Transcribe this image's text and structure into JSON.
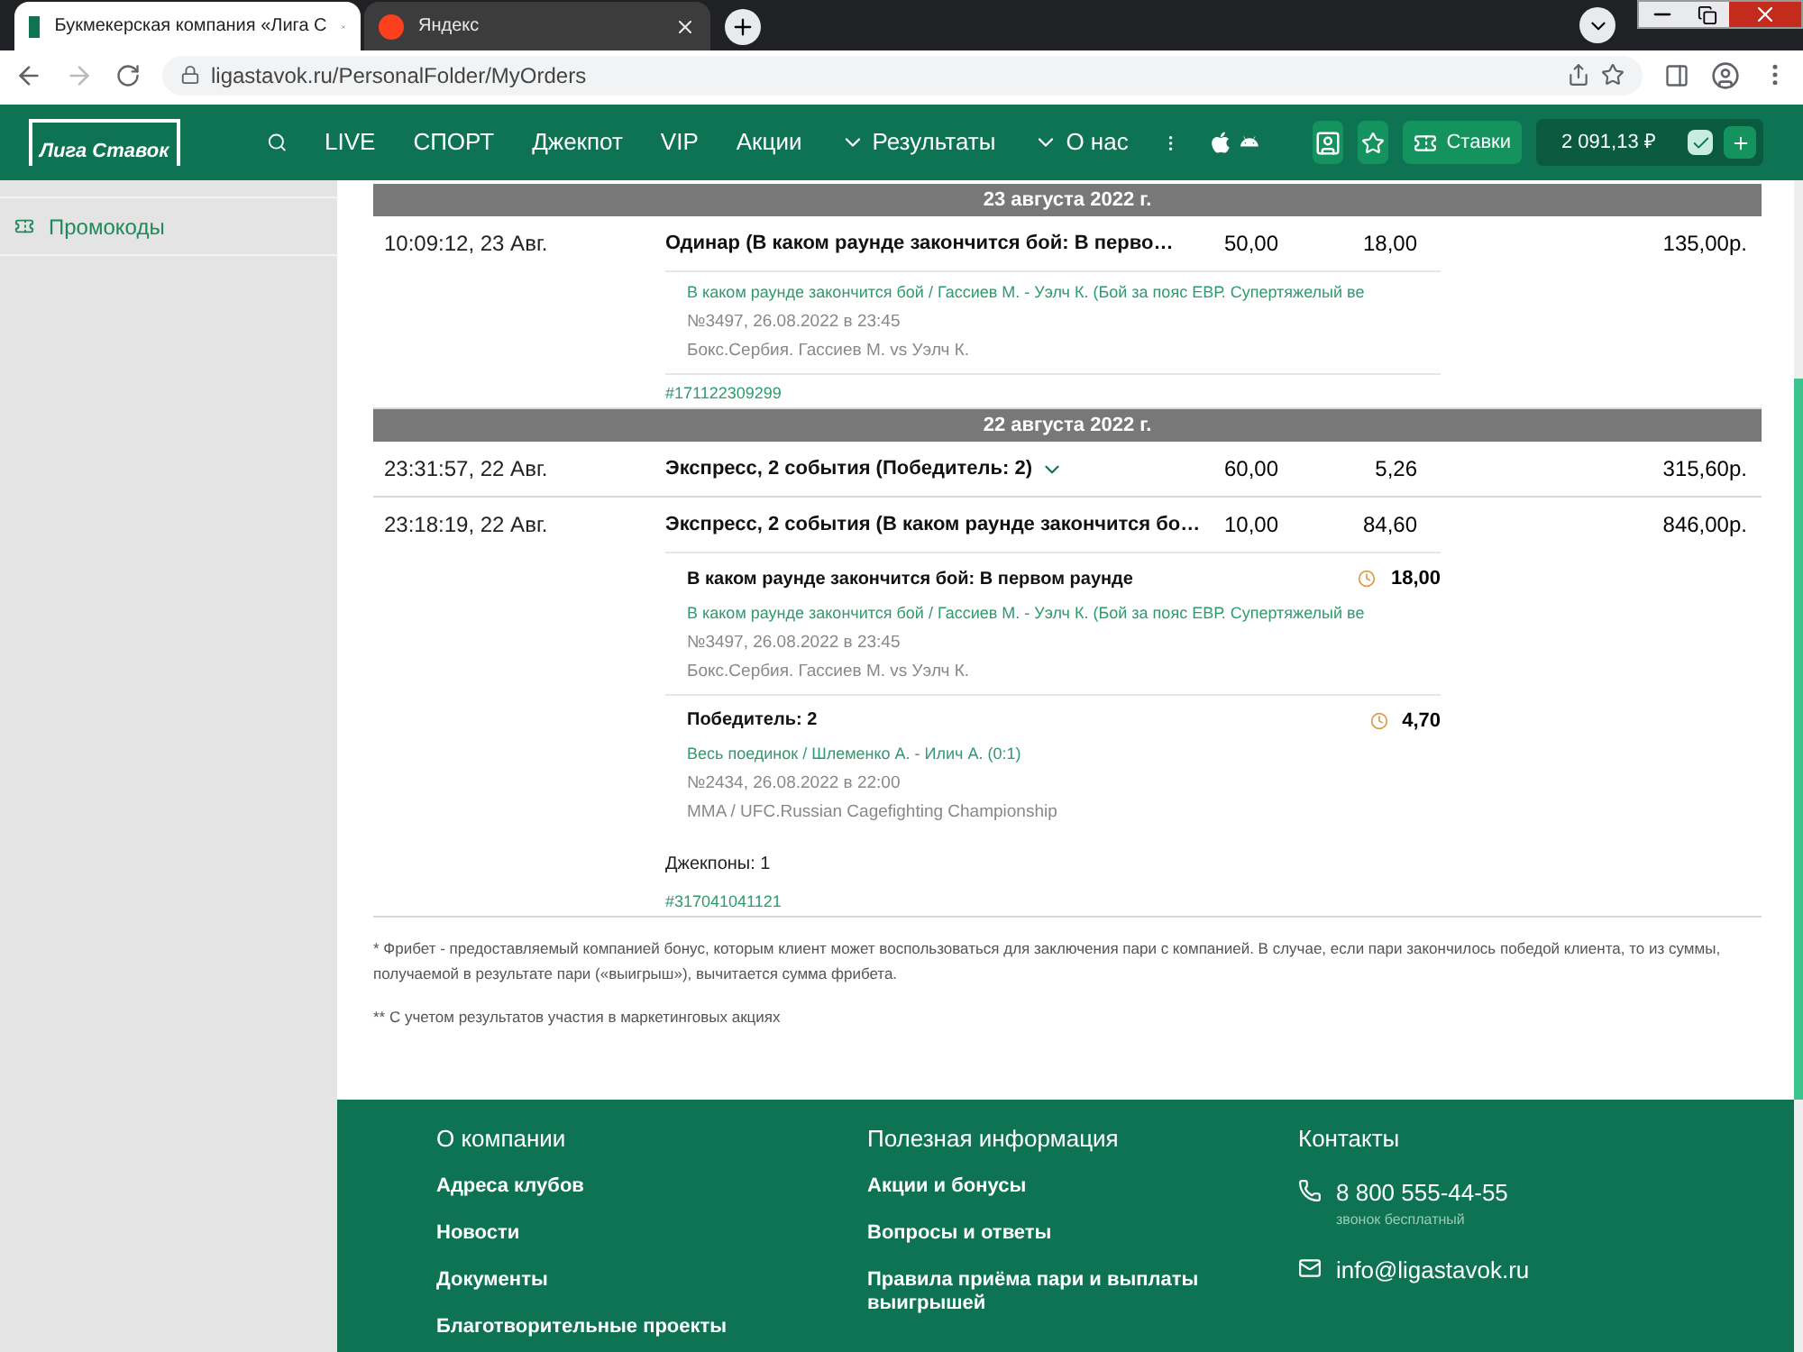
{
  "browser": {
    "tabs": [
      {
        "title": "Букмекерская компания «Лига С",
        "selected": true,
        "kind": "site"
      },
      {
        "title": "Яндекс",
        "selected": false,
        "kind": "yandex"
      }
    ],
    "url": "ligastavok.ru/PersonalFolder/MyOrders"
  },
  "header": {
    "logo": "Лига Ставок",
    "nav": [
      {
        "label": "LIVE",
        "kind": "link"
      },
      {
        "label": "СПОРТ",
        "kind": "link"
      },
      {
        "label": "Джекпот",
        "kind": "link"
      },
      {
        "label": "VIP",
        "kind": "link"
      },
      {
        "label": "Акции",
        "kind": "link"
      },
      {
        "label": "Результаты",
        "kind": "dropdown"
      },
      {
        "label": "О нас",
        "kind": "dropdown"
      }
    ],
    "bets_button": "Ставки",
    "balance": "2 091,13 ₽"
  },
  "sidebar": {
    "items": [
      {
        "label": "Промокоды"
      }
    ]
  },
  "groups": [
    {
      "date": "23 августа 2022 г.",
      "orders": [
        {
          "time": "10:09:12, 23 Авг.",
          "title": "Одинар (В каком раунде закончится бой: В перво…",
          "expanded": true,
          "stake": "50,00",
          "coef": "18,00",
          "payout": "135,00р.",
          "selections": [
            {
              "market": "В каком раунде закончится бой / Гассиев М. - Уэлч К. (Бой за пояс ЕВР. Супертяжелый ве",
              "event": "№3497, 26.08.2022 в 23:45",
              "league": "Бокс.Сербия. Гассиев М. vs Уэлч К."
            }
          ],
          "id": "#171122309299"
        }
      ]
    },
    {
      "date": "22 августа 2022 г.",
      "orders": [
        {
          "time": "23:31:57, 22 Авг.",
          "title": "Экспресс, 2 события (Победитель: 2)",
          "expanded": false,
          "stake": "60,00",
          "coef": "5,26",
          "payout": "315,60р."
        },
        {
          "time": "23:18:19, 22 Авг.",
          "title": "Экспресс, 2 события (В каком раунде закончится бо…",
          "expanded": true,
          "stake": "10,00",
          "coef": "84,60",
          "payout": "846,00р.",
          "selections": [
            {
              "title": "В каком раунде закончится бой: В первом раунде",
              "coef": "18,00",
              "market": "В каком раунде закончится бой / Гассиев М. - Уэлч К. (Бой за пояс ЕВР. Супертяжелый ве",
              "event": "№3497, 26.08.2022 в 23:45",
              "league": "Бокс.Сербия. Гассиев М. vs Уэлч К."
            },
            {
              "title": "Победитель: 2",
              "coef": "4,70",
              "market": "Весь поединок / Шлеменко А. - Илич А. (0:1)",
              "event": "№2434, 26.08.2022 в 22:00",
              "league": "MMA / UFC.Russian Cagefighting Championship"
            }
          ],
          "jackpots": "Джекпоны: 1",
          "id": "#317041041121"
        }
      ]
    }
  ],
  "footnotes": [
    "* Фрибет - предоставляемый компанией бонус, которым клиент может воспользоваться для заключения пари с компанией. В случае, если пари закончилось победой клиента, то из суммы, получаемой в результате пари («выигрыш»), вычитается сумма фрибета.",
    "** С учетом результатов участия в маркетинговых акциях"
  ],
  "footer": {
    "columns": [
      {
        "title": "О компании",
        "links": [
          "Адреса клубов",
          "Новости",
          "Документы",
          "Благотворительные проекты"
        ]
      },
      {
        "title": "Полезная информация",
        "links": [
          "Акции и бонусы",
          "Вопросы и ответы",
          "Правила приёма пари и выплаты выигрышей"
        ]
      }
    ],
    "contacts": {
      "title": "Контакты",
      "items": [
        {
          "kind": "phone",
          "text": "8 800 555-44-55",
          "note": "звонок бесплатный"
        },
        {
          "kind": "email",
          "text": "info@ligastavok.ru"
        }
      ]
    }
  }
}
